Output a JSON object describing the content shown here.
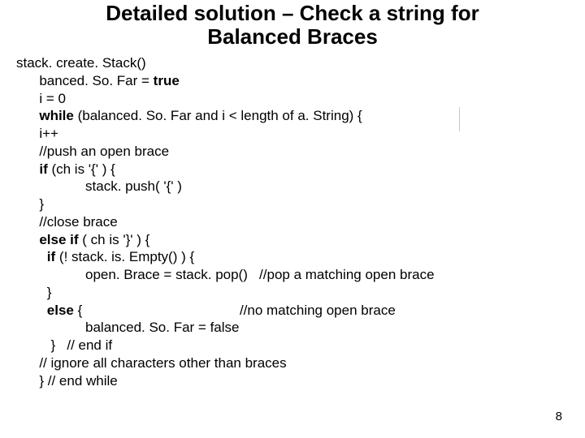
{
  "title_line1": "Detailed solution – Check a string for",
  "title_line2": "Balanced Braces",
  "code": {
    "l1": "stack. create. Stack()",
    "l2": "      banced. So. Far = ",
    "l2b": "true",
    "l3": "      i = 0",
    "l4a": "      ",
    "l4b": "while",
    "l4c": " (balanced. So. Far and i < length of a. String) {",
    "l5": "      i++",
    "l6": "      //push an open brace",
    "l7a": "      ",
    "l7b": "if",
    "l7c": " (ch is '{' ) {",
    "l8": "                  stack. push( '{' )",
    "l9": "      }",
    "l10": "      //close brace",
    "l11a": "      ",
    "l11b": "else if",
    "l11c": " ( ch is '}' ) {",
    "l12a": "        ",
    "l12b": "if",
    "l12c": " (! stack. is. Empty() ) {",
    "l13": "                  open. Brace = stack. pop()   //pop a matching open brace",
    "l14": "        }",
    "l15a": "        ",
    "l15b": "else",
    "l15c": " {                                         //no matching open brace",
    "l16": "                  balanced. So. Far = false",
    "l17": "         }   // end if",
    "l18": "      // ignore all characters other than braces",
    "l19": "      } // end while"
  },
  "page_number": "8"
}
